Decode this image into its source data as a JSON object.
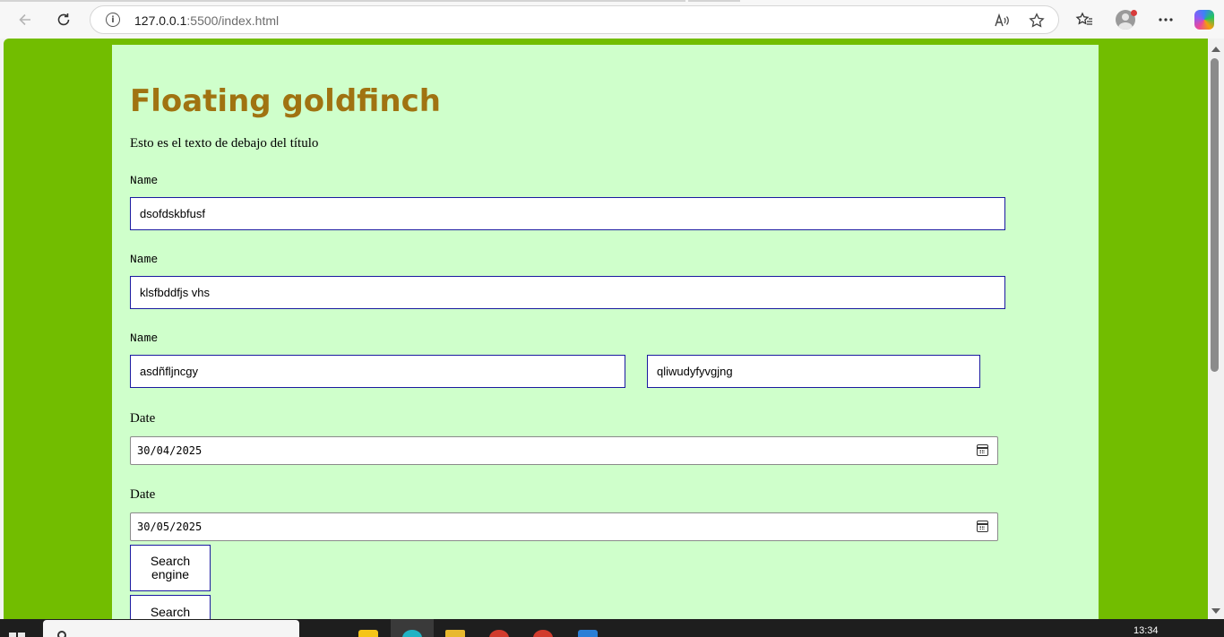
{
  "browser": {
    "url_host": "127.0.0.1",
    "url_rest": ":5500/index.html"
  },
  "page": {
    "title": "Floating goldfinch",
    "subtitle": "Esto es el texto de debajo del título",
    "fields": [
      {
        "label": "Name",
        "value": "dsofdskbfusf"
      },
      {
        "label": "Name",
        "value": "klsfbddfjs vhs"
      },
      {
        "label": "Name",
        "value_left": "asdñfljncgy",
        "value_right": "qliwudyfyvgjng"
      }
    ],
    "dates": [
      {
        "label": "Date",
        "value": "30/04/2025"
      },
      {
        "label": "Date",
        "value": "30/05/2025"
      }
    ],
    "buttons": {
      "search_engine": "Search engine",
      "search": "Search"
    }
  },
  "taskbar": {
    "time": "13:34"
  },
  "colors": {
    "page_background": "#72bd00",
    "container_background": "#cfffcb",
    "title_color": "#a07311",
    "input_border": "#1a1aa0"
  }
}
